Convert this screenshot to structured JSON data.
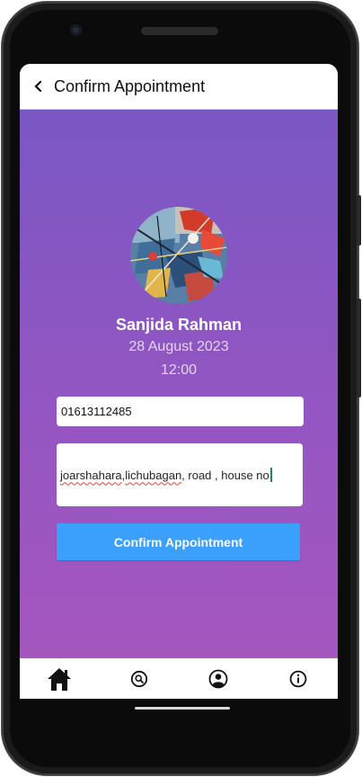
{
  "appbar": {
    "title": "Confirm Appointment",
    "back_icon": "chevron-left-icon"
  },
  "profile": {
    "name": "Sanjida Rahman",
    "date": "28 August 2023",
    "time": "12:00"
  },
  "form": {
    "phone_value": "01613112485",
    "address_parts": [
      "joarshahara",
      ", ",
      "lichubagan",
      " , road , house no"
    ]
  },
  "confirm_button": {
    "label": "Confirm Appointment",
    "color": "#3ba0fb"
  },
  "bottom_nav": {
    "items": [
      {
        "icon": "home-icon"
      },
      {
        "icon": "search-icon"
      },
      {
        "icon": "account-icon"
      },
      {
        "icon": "info-icon"
      }
    ]
  },
  "colors": {
    "gradient_top": "#7a57c4",
    "gradient_bottom": "#a556bf"
  }
}
